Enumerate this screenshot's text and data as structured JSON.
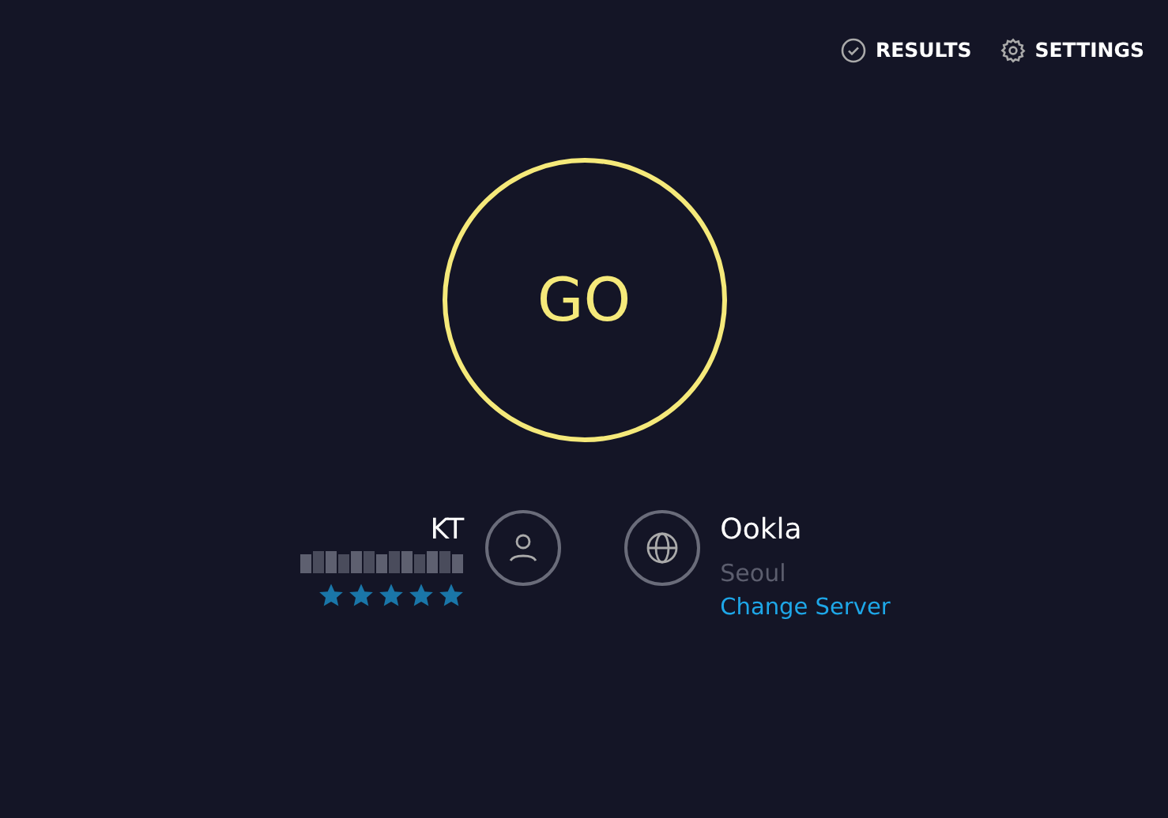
{
  "nav": [
    {
      "kind": "results",
      "label": "RESULTS"
    },
    {
      "kind": "settings",
      "label": "SETTINGS"
    }
  ],
  "go_button": {
    "label": "GO"
  },
  "provider": {
    "name": "KT",
    "stars": 5
  },
  "server": {
    "name": "Ookla",
    "location": "Seoul",
    "change_link": "Change Server"
  }
}
